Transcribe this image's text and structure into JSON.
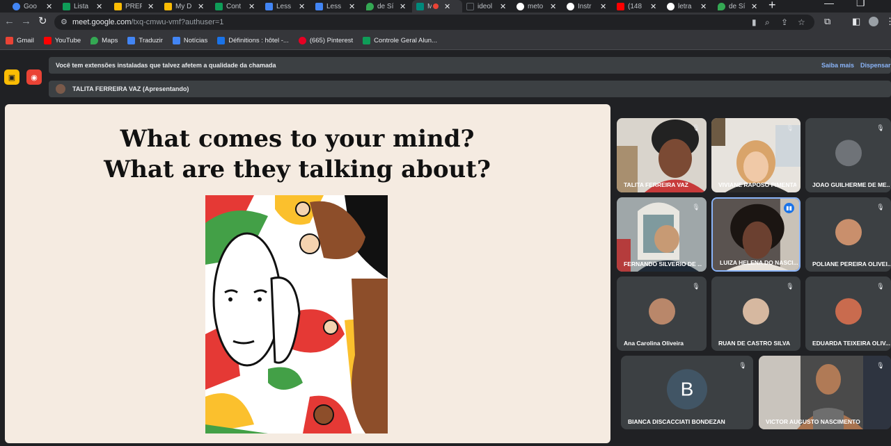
{
  "browser": {
    "tabs": [
      {
        "title": "Goo",
        "color": "#4285f4"
      },
      {
        "title": "Lista",
        "color": "#0f9d58"
      },
      {
        "title": "PREF",
        "color": "#fbbc04"
      },
      {
        "title": "My D",
        "color": "#fbbc04"
      },
      {
        "title": "Cont",
        "color": "#0f9d58"
      },
      {
        "title": "Less",
        "color": "#4285f4"
      },
      {
        "title": "Less",
        "color": "#4285f4"
      },
      {
        "title": "de Sí",
        "color": "#34a853"
      },
      {
        "title": "M",
        "color": "#00897b"
      },
      {
        "title": "ideol",
        "color": "#202124"
      },
      {
        "title": "meto",
        "color": "#4285f4"
      },
      {
        "title": "Instr",
        "color": "#4285f4"
      },
      {
        "title": "(148",
        "color": "#ff0000"
      },
      {
        "title": "letra",
        "color": "#4285f4"
      },
      {
        "title": "de Sí",
        "color": "#34a853"
      }
    ],
    "new_tab_symbol": "+",
    "url_host": "meet.google.com",
    "url_path": "/txq-cmwu-vmf?authuser=1",
    "bookmarks": [
      {
        "label": "Gmail",
        "color": "#ea4335"
      },
      {
        "label": "YouTube",
        "color": "#ff0000"
      },
      {
        "label": "Maps",
        "color": "#34a853"
      },
      {
        "label": "Traduzir",
        "color": "#4285f4"
      },
      {
        "label": "Notícias",
        "color": "#4285f4"
      },
      {
        "label": "Définitions : hôtel -...",
        "color": "#1a73e8"
      },
      {
        "label": "(665) Pinterest",
        "color": "#e60023"
      },
      {
        "label": "Controle Geral Alun...",
        "color": "#0f9d58"
      }
    ]
  },
  "meet": {
    "extension_warning": "Você tem extensões instaladas que talvez afetem a qualidade da chamada",
    "learn_more": "Saiba mais",
    "dismiss": "Dispensar",
    "presenter_label": "TALITA FERREIRA VAZ (Apresentando)",
    "slide": {
      "line1": "What comes to your mind?",
      "line2": "What are they talking about?"
    },
    "participants": [
      {
        "name": "TALITA FERREIRA VAZ",
        "type": "video",
        "muted": true
      },
      {
        "name": "VIVIANE RAPOSO PIMENTA",
        "type": "video",
        "muted": true
      },
      {
        "name": "JOAO GUILHERME DE ME...",
        "type": "avatar",
        "muted": true
      },
      {
        "name": "FERNANDO SILVERIO DE ...",
        "type": "video",
        "muted": true
      },
      {
        "name": "LUIZA HELENA DO NASCI...",
        "type": "video",
        "muted": false,
        "speaking": true
      },
      {
        "name": "POLIANE PEREIRA OLIVEI...",
        "type": "avatar",
        "muted": true
      },
      {
        "name": "Ana Carolina Oliveira",
        "type": "avatar",
        "muted": true
      },
      {
        "name": "RUAN DE CASTRO SILVA",
        "type": "avatar",
        "muted": true
      },
      {
        "name": "EDUARDA TEIXEIRA OLIV...",
        "type": "avatar",
        "muted": true
      },
      {
        "name": "BIANCA DISCACCIATI BONDEZAN",
        "type": "letter",
        "letter": "B",
        "muted": true
      },
      {
        "name": "VICTOR AUGUSTO NASCIMENTO",
        "type": "video",
        "muted": true
      }
    ]
  }
}
